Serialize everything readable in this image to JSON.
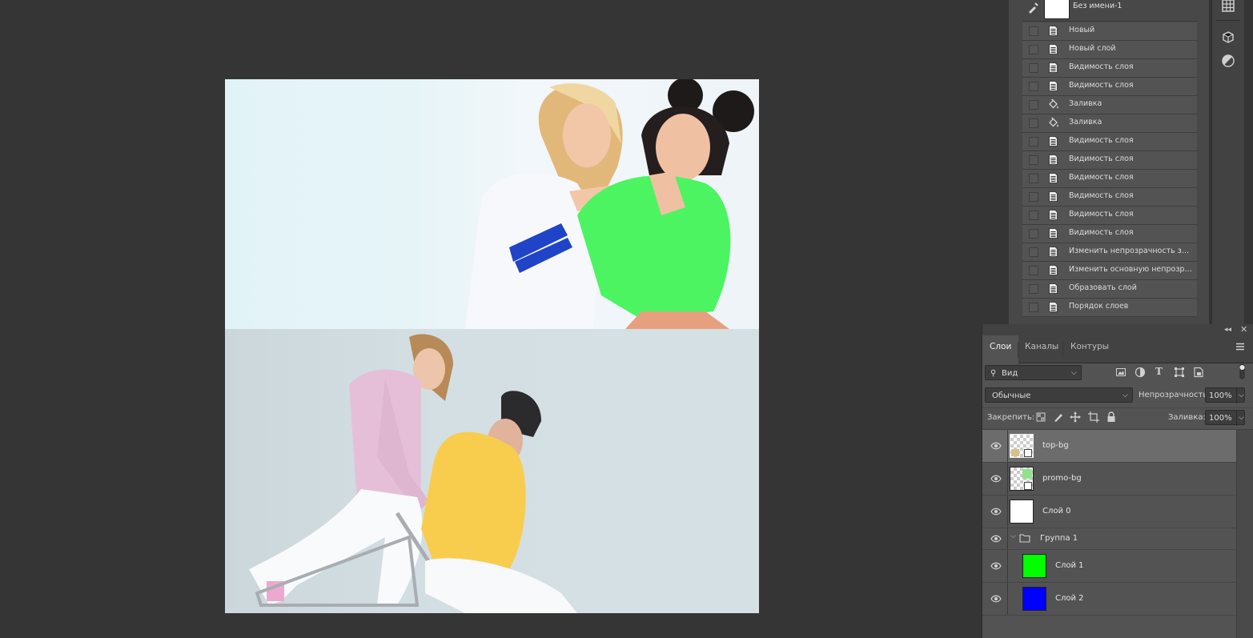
{
  "history": {
    "snapshot_label": "Без имени-1",
    "items": [
      {
        "label": "Новый",
        "icon": "document-icon"
      },
      {
        "label": "Новый слой",
        "icon": "document-icon"
      },
      {
        "label": "Видимость слоя",
        "icon": "document-icon"
      },
      {
        "label": "Видимость слоя",
        "icon": "document-icon"
      },
      {
        "label": "Заливка",
        "icon": "paint-bucket-icon"
      },
      {
        "label": "Заливка",
        "icon": "paint-bucket-icon"
      },
      {
        "label": "Видимость слоя",
        "icon": "document-icon"
      },
      {
        "label": "Видимость слоя",
        "icon": "document-icon"
      },
      {
        "label": "Видимость слоя",
        "icon": "document-icon"
      },
      {
        "label": "Видимость слоя",
        "icon": "document-icon"
      },
      {
        "label": "Видимость слоя",
        "icon": "document-icon"
      },
      {
        "label": "Видимость слоя",
        "icon": "document-icon"
      },
      {
        "label": "Изменить непрозрачность за...",
        "icon": "document-icon"
      },
      {
        "label": "Изменить основную непрозра...",
        "icon": "document-icon"
      },
      {
        "label": "Образовать слой",
        "icon": "document-icon"
      },
      {
        "label": "Порядок слоев",
        "icon": "document-icon"
      }
    ]
  },
  "layers_panel": {
    "tabs": [
      "Слои",
      "Каналы",
      "Контуры"
    ],
    "active_tab": "Слои",
    "filter_label": "Вид",
    "blend_mode": "Обычные",
    "opacity_label": "Непрозрачность:",
    "opacity_value": "100%",
    "lock_label": "Закрепить:",
    "fill_label": "Заливка:",
    "fill_value": "100%",
    "layers": [
      {
        "name": "top-bg",
        "type": "smart",
        "selected": true
      },
      {
        "name": "promo-bg",
        "type": "smart",
        "selected": false
      },
      {
        "name": "Слой 0",
        "type": "pixel",
        "color": "#ffffff"
      },
      {
        "name": "Группа 1",
        "type": "group"
      },
      {
        "name": "Слой 1",
        "type": "pixel",
        "color": "#00ff00"
      },
      {
        "name": "Слой 2",
        "type": "pixel",
        "color": "#0000ff"
      }
    ]
  },
  "colors": {
    "workspace_bg": "#353535",
    "panel_bg": "#535353",
    "selected_row": "#6c6c6c",
    "layer1_fill": "#00ff00",
    "layer2_fill": "#0000ff"
  }
}
